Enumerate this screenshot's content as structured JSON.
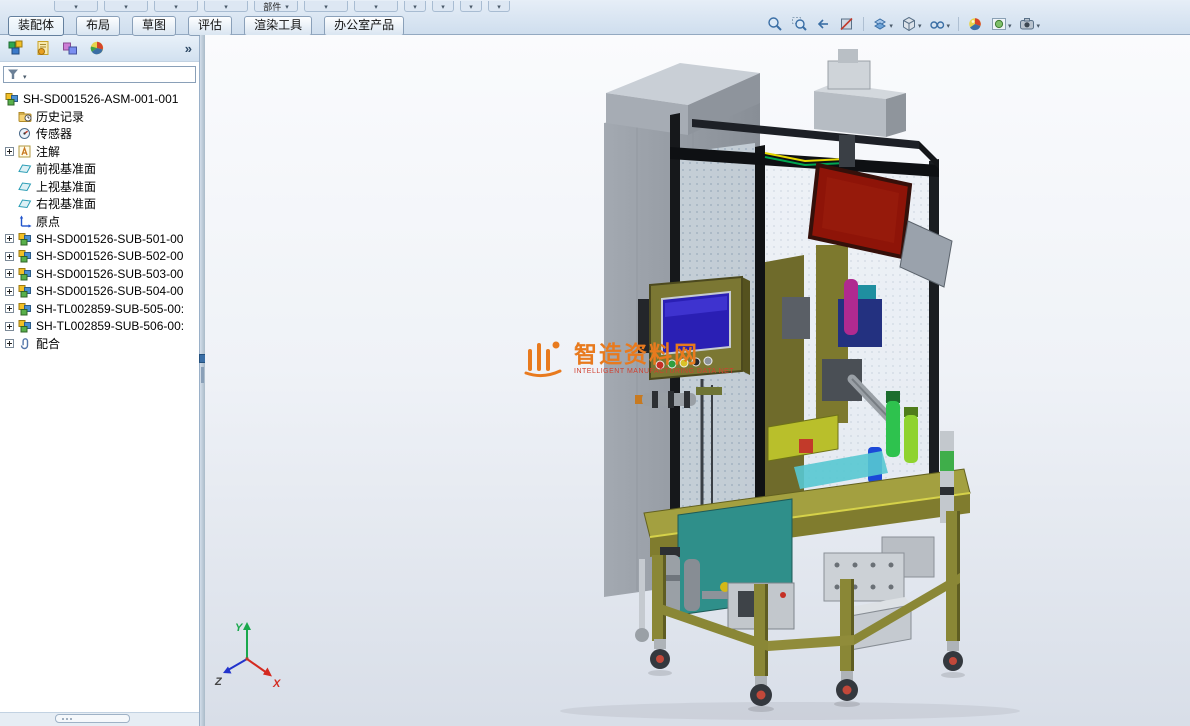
{
  "ribbon": {
    "partial_label": "部件",
    "tabs": [
      {
        "label": "装配体"
      },
      {
        "label": "布局"
      },
      {
        "label": "草图"
      },
      {
        "label": "评估"
      },
      {
        "label": "渲染工具"
      },
      {
        "label": "办公室产品"
      }
    ],
    "headsup_icons": [
      "zoom-fit",
      "zoom-area",
      "previous-view",
      "section-view",
      "view-orientation",
      "display-style",
      "hide-show-items",
      "edit-appearance",
      "apply-scene",
      "view-settings"
    ]
  },
  "feature_panel": {
    "toolbar_icons": [
      "featuremanager-tree",
      "propertymanager",
      "configurationmanager",
      "displaymanager"
    ],
    "expand_chevron": "»",
    "root_label": "SH-SD001526-ASM-001-001",
    "items": [
      {
        "label": "历史记录",
        "icon": "history"
      },
      {
        "label": "传感器",
        "icon": "sensors"
      },
      {
        "label": "注解",
        "icon": "annotations",
        "expandable": true
      },
      {
        "label": "前视基准面",
        "icon": "plane"
      },
      {
        "label": "上视基准面",
        "icon": "plane"
      },
      {
        "label": "右视基准面",
        "icon": "plane"
      },
      {
        "label": "原点",
        "icon": "origin"
      },
      {
        "label": "SH-SD001526-SUB-501-00",
        "icon": "subassembly",
        "expandable": true
      },
      {
        "label": "SH-SD001526-SUB-502-00",
        "icon": "subassembly",
        "expandable": true
      },
      {
        "label": "SH-SD001526-SUB-503-00",
        "icon": "subassembly",
        "expandable": true
      },
      {
        "label": "SH-SD001526-SUB-504-00",
        "icon": "subassembly",
        "expandable": true
      },
      {
        "label": "SH-TL002859-SUB-505-00:",
        "icon": "subassembly",
        "expandable": true
      },
      {
        "label": "SH-TL002859-SUB-506-00:",
        "icon": "subassembly",
        "expandable": true
      },
      {
        "label": "配合",
        "icon": "mates",
        "expandable": true
      }
    ]
  },
  "viewport": {
    "watermark": {
      "title": "智造资料网",
      "subtitle": "INTELLIGENT MANUFACTURING DATA NET",
      "color": "#e87a1e"
    },
    "triad": {
      "x": "X",
      "y": "Y",
      "z": "Z"
    },
    "model_colors": {
      "cabinet_gray": "#989ea6",
      "frame_black": "#17191c",
      "table_olive": "#a3a040",
      "panel_red": "#8e1408",
      "screen_blue": "#2a1fb4",
      "teal_panel": "#2f8f8a",
      "cylinder_green": "#2ec24e"
    }
  }
}
